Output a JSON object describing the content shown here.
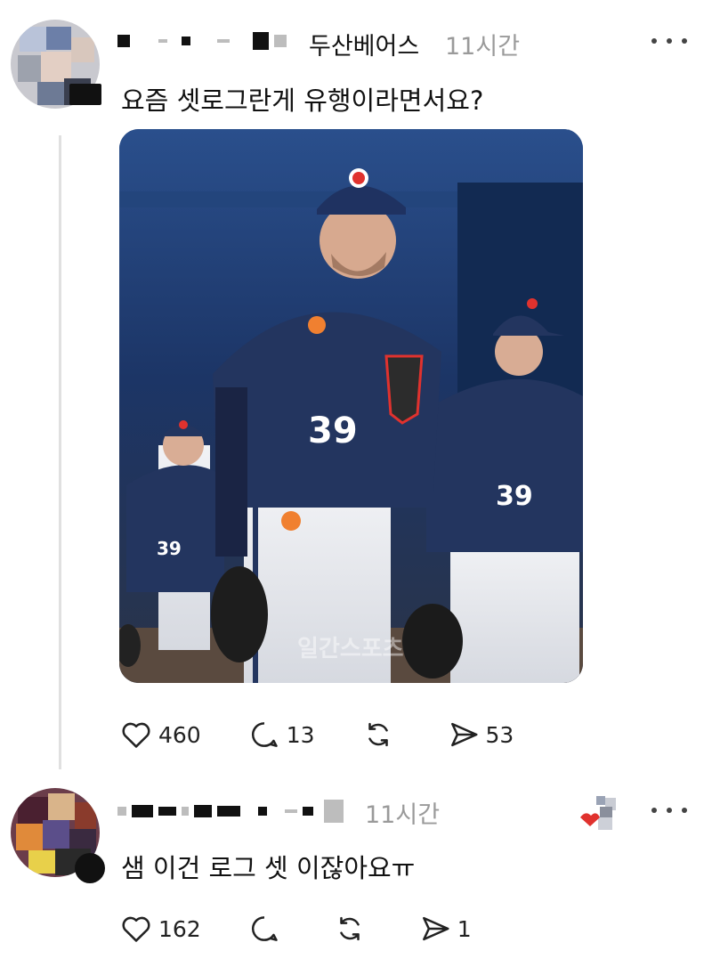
{
  "post": {
    "handle": "두산베어스",
    "time": "11시간",
    "text": "요즘 셋로그란게 유행이라면서요?",
    "media": {
      "jersey_number": "39",
      "watermark": "일간스포츠"
    },
    "actions": {
      "likes": "460",
      "replies": "13",
      "reposts": "",
      "shares": "53"
    }
  },
  "reply": {
    "time": "11시간",
    "text": "샘 이건 로그 셋 이잖아요ㅠ",
    "actions": {
      "likes": "162",
      "replies": "",
      "reposts": "",
      "shares": "1"
    }
  },
  "colors": {
    "jersey": "#23355f",
    "accent": "#e0322e",
    "stadium_blue": "#1d3b6e",
    "muted_text": "#9a9a9a"
  },
  "icons": [
    "heart-icon",
    "comment-icon",
    "repost-icon",
    "share-icon",
    "more-icon"
  ]
}
